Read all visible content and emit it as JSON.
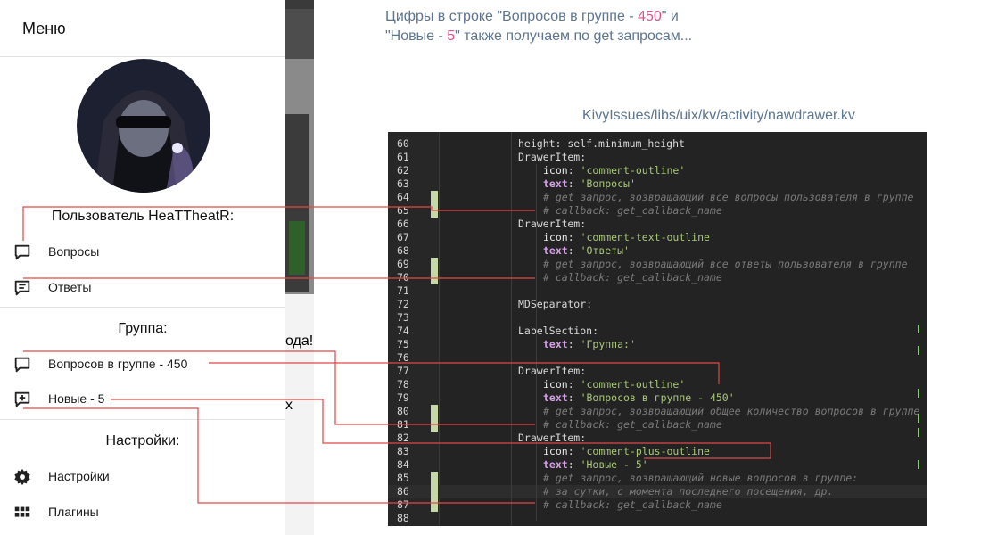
{
  "drawer": {
    "title": "Меню",
    "user_header": "Пользователь HeaTTheatR:",
    "items_user": [
      {
        "label": "Вопросы",
        "icon": "comment-outline-icon"
      },
      {
        "label": "Ответы",
        "icon": "comment-text-outline-icon"
      }
    ],
    "group_title": "Группа:",
    "items_group": [
      {
        "label": "Вопросов в группе - 450",
        "icon": "comment-outline-icon"
      },
      {
        "label": "Новые - 5",
        "icon": "comment-plus-outline-icon"
      }
    ],
    "settings_title": "Настройки:",
    "items_settings": [
      {
        "label": "Настройки",
        "icon": "gear-icon"
      },
      {
        "label": "Плагины",
        "icon": "apps-grid-icon"
      }
    ]
  },
  "background_fragments": {
    "frag1": "ода!",
    "frag2": "x"
  },
  "annotation": {
    "line1_pre": "Цифры в строке \"Вопросов в группе - ",
    "line1_num": "450",
    "line1_post": "\" и",
    "line2_pre": "\"Новые - ",
    "line2_num": "5",
    "line2_post": "\" также получаем по get запросам..."
  },
  "file_path": "KivyIssues/libs/uix/kv/activity/nawdrawer.kv",
  "editor": {
    "top_partial": "height: self.minimum_height",
    "lines": [
      {
        "n": "60",
        "code": ""
      },
      {
        "n": "61",
        "code": "DrawerItem:"
      },
      {
        "n": "62",
        "prop": "icon",
        "val": "'comment-outline'"
      },
      {
        "n": "63",
        "prop": "text",
        "val": "'Вопросы'"
      },
      {
        "n": "64",
        "comment": "# get запрос, возвращающий все вопросы пользователя в группе"
      },
      {
        "n": "65",
        "comment": "# callback: get_callback_name"
      },
      {
        "n": "66",
        "code": "DrawerItem:"
      },
      {
        "n": "67",
        "prop": "icon",
        "val": "'comment-text-outline'"
      },
      {
        "n": "68",
        "prop": "text",
        "val": "'Ответы'"
      },
      {
        "n": "69",
        "comment": "# get запрос, возвращающий все ответы пользователя в группе"
      },
      {
        "n": "70",
        "comment": "# callback: get_callback_name"
      },
      {
        "n": "71",
        "code": ""
      },
      {
        "n": "72",
        "code": "MDSeparator:"
      },
      {
        "n": "73",
        "code": ""
      },
      {
        "n": "74",
        "code": "LabelSection:"
      },
      {
        "n": "75",
        "prop": "text",
        "val": "'Группа:'"
      },
      {
        "n": "76",
        "code": ""
      },
      {
        "n": "77",
        "code": "DrawerItem:"
      },
      {
        "n": "78",
        "prop": "icon",
        "val": "'comment-outline'"
      },
      {
        "n": "79",
        "prop": "text",
        "val": "'Вопросов в группе - 450'"
      },
      {
        "n": "80",
        "comment": "# get запрос, возвращающий общее количество вопросов в группе"
      },
      {
        "n": "81",
        "comment": "# callback: get_callback_name"
      },
      {
        "n": "82",
        "code": "DrawerItem:"
      },
      {
        "n": "83",
        "prop": "icon",
        "val": "'comment-plus-outline'"
      },
      {
        "n": "84",
        "prop": "text",
        "val": "'Новые - 5'"
      },
      {
        "n": "85",
        "comment": "# get запрос, возвращающий новые вопросов в группе:"
      },
      {
        "n": "86",
        "comment": "# за сутки, с момента последнего посещения, др."
      },
      {
        "n": "87",
        "comment": "# callback: get_callback_name"
      },
      {
        "n": "88",
        "code": ""
      }
    ]
  },
  "colors": {
    "annotation_text": "#5d7590",
    "highlight_number": "#e0528a",
    "connector_line": "#e04848",
    "editor_bg": "#232323",
    "keyword_purple": "#d6a0e8",
    "string_green": "#a8c87a"
  }
}
